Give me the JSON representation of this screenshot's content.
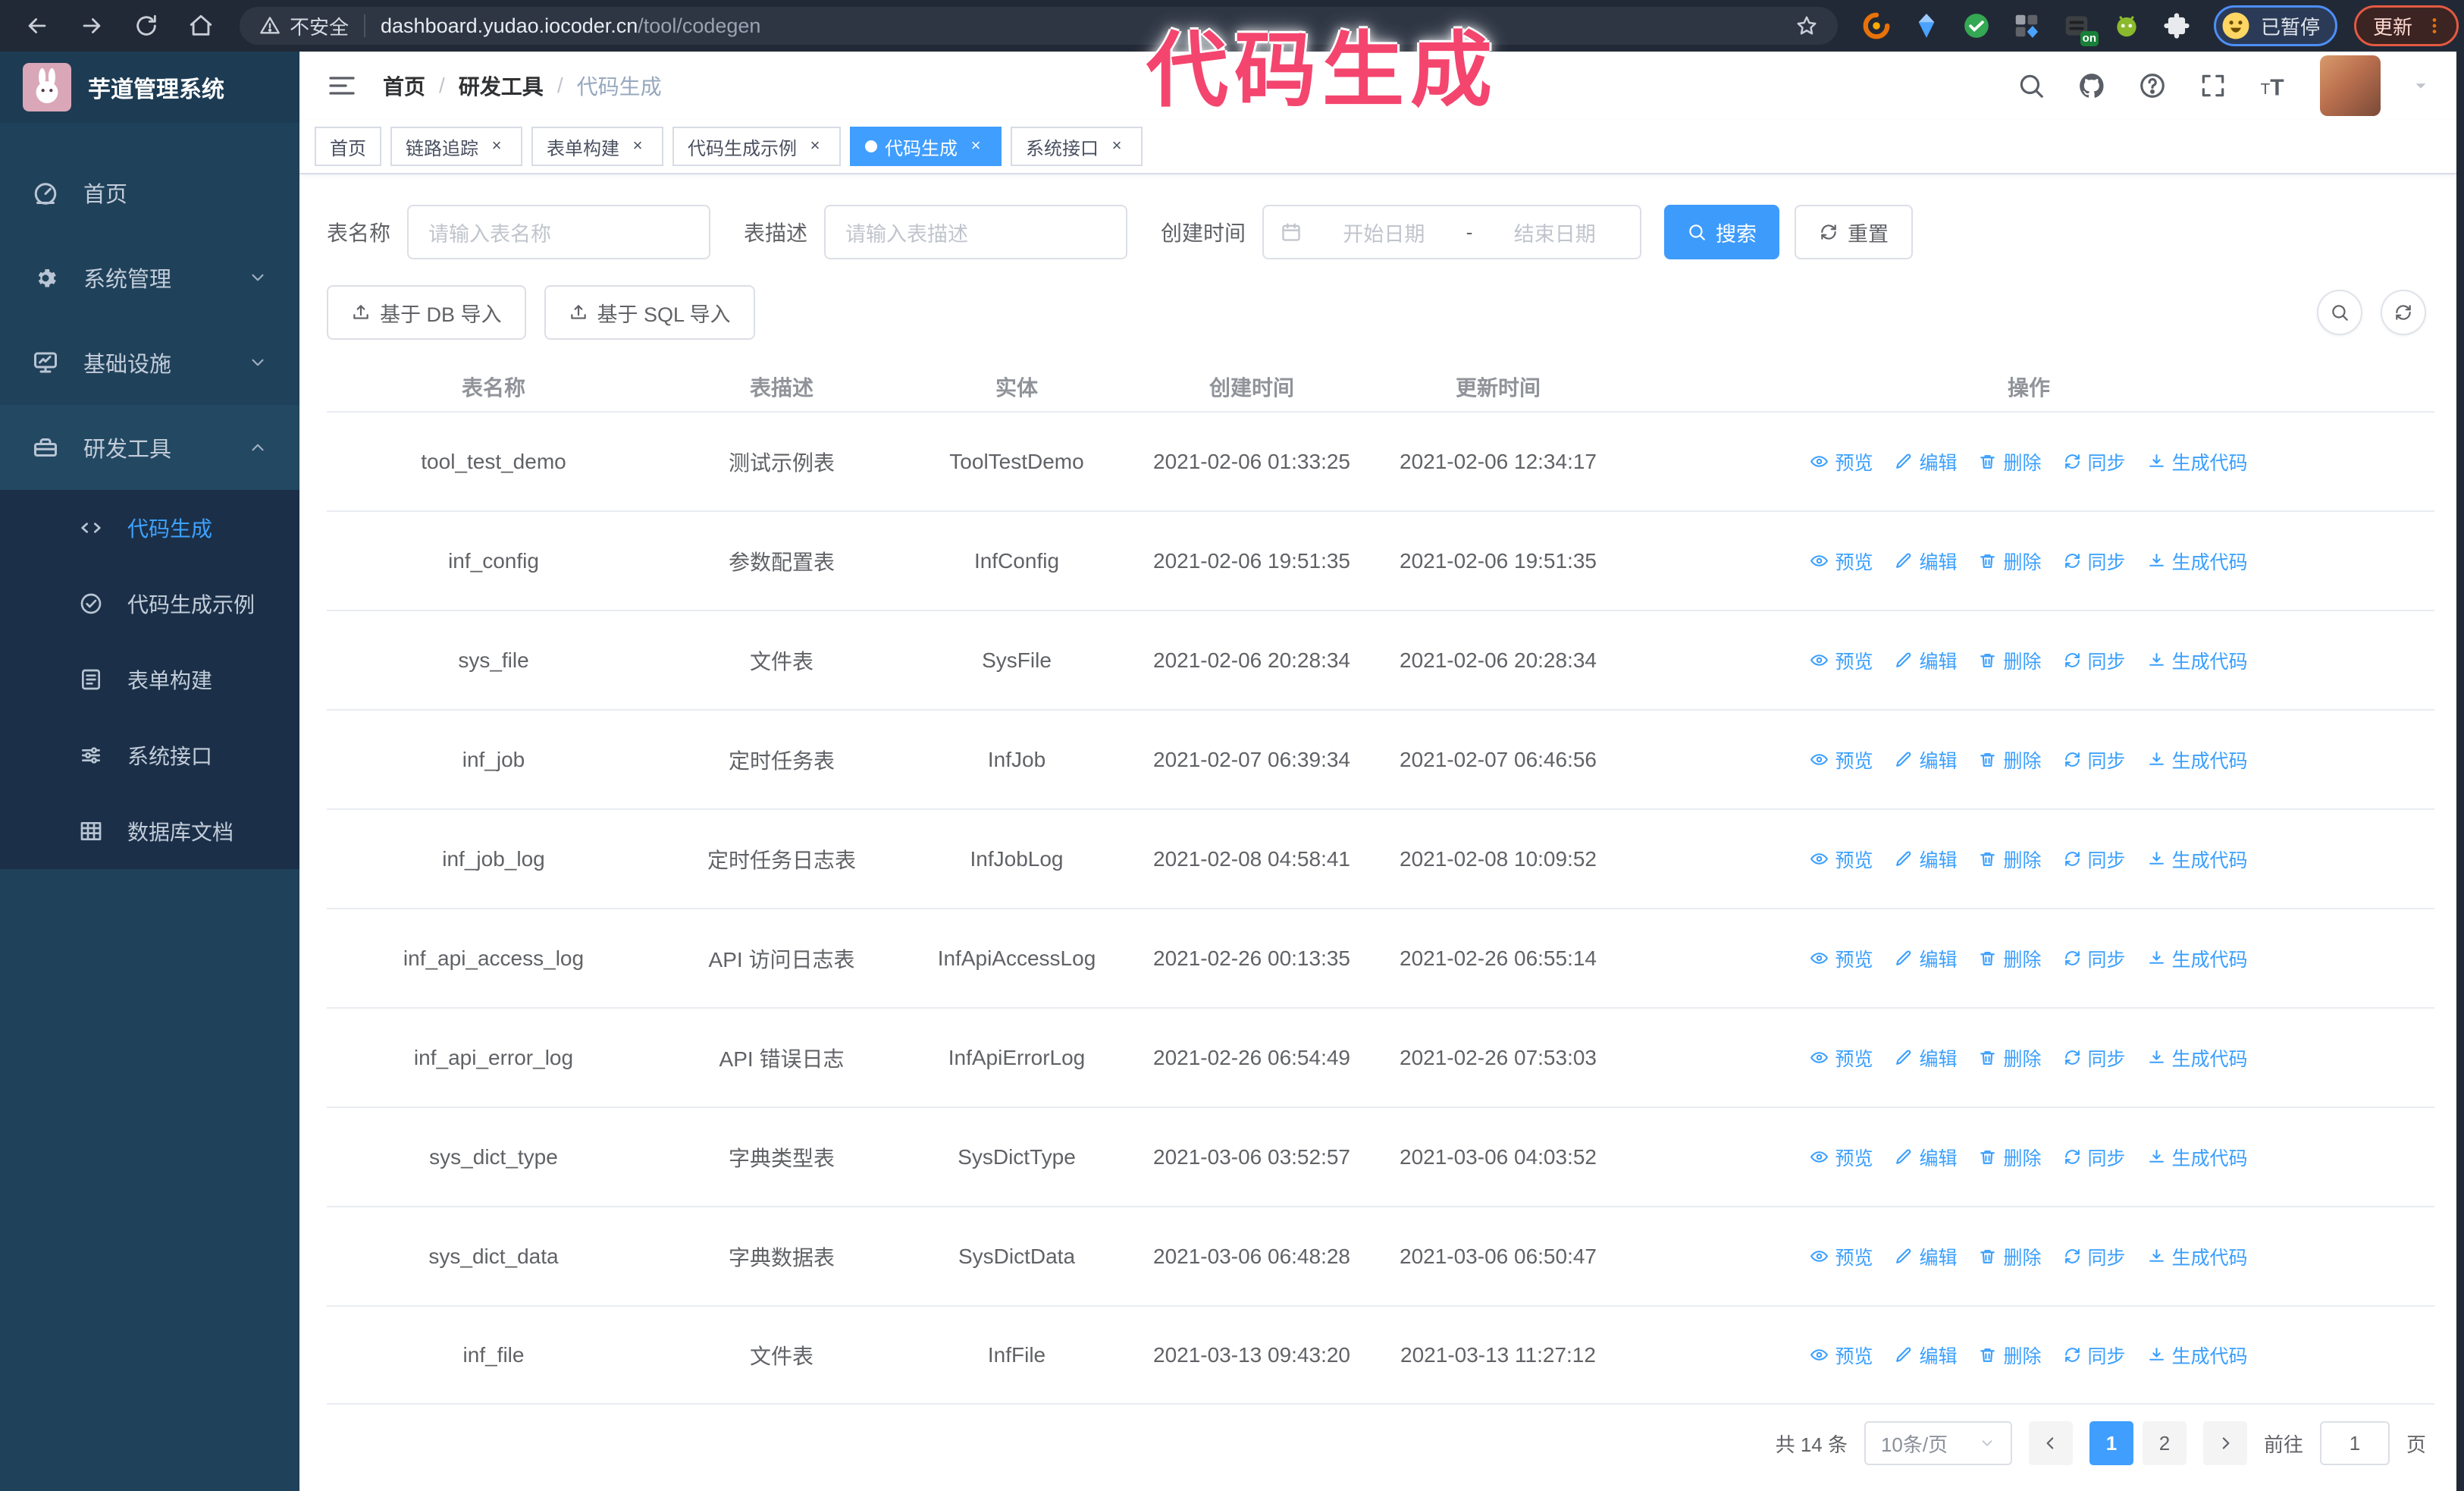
{
  "colors": {
    "accent": "#409eff",
    "sidebar_bg": "#20415a",
    "submenu_bg": "#1b3048",
    "annotation": "#f4456e"
  },
  "browser": {
    "security_label": "不安全",
    "url_host": "dashboard.yudao.iocoder.cn",
    "url_path": "/tool/codegen",
    "profile_chip": "已暂停",
    "update_button": "更新",
    "extensions": [
      {
        "icon": "orange-swirl-extension-icon",
        "badge": ""
      },
      {
        "icon": "blue-gem-extension-icon",
        "badge": ""
      },
      {
        "icon": "green-check-extension-icon",
        "badge": ""
      },
      {
        "icon": "grid-extension-icon",
        "badge": ""
      },
      {
        "icon": "dark-extension-icon",
        "badge": "on"
      },
      {
        "icon": "green-bot-extension-icon",
        "badge": ""
      },
      {
        "icon": "puzzle-extensions-icon",
        "badge": ""
      }
    ]
  },
  "annotation": {
    "text": "代码生成"
  },
  "sidebar": {
    "logo_title": "芋道管理系统",
    "menu": [
      {
        "label": "首页",
        "icon": "dashboard-icon",
        "chevron": ""
      },
      {
        "label": "系统管理",
        "icon": "gear-icon",
        "chevron": "down"
      },
      {
        "label": "基础设施",
        "icon": "monitor-icon",
        "chevron": "down"
      },
      {
        "label": "研发工具",
        "icon": "toolbox-icon",
        "chevron": "up",
        "open": true
      }
    ],
    "submenu": [
      {
        "label": "代码生成",
        "icon": "code-icon",
        "active": true
      },
      {
        "label": "代码生成示例",
        "icon": "example-icon",
        "active": false
      },
      {
        "label": "表单构建",
        "icon": "form-icon",
        "active": false
      },
      {
        "label": "系统接口",
        "icon": "api-icon",
        "active": false
      },
      {
        "label": "数据库文档",
        "icon": "database-doc-icon",
        "active": false
      }
    ]
  },
  "breadcrumb": {
    "items": [
      "首页",
      "研发工具"
    ],
    "current": "代码生成",
    "separator": "/"
  },
  "tags": [
    {
      "label": "首页",
      "closable": false,
      "active": false
    },
    {
      "label": "链路追踪",
      "closable": true,
      "active": false
    },
    {
      "label": "表单构建",
      "closable": true,
      "active": false
    },
    {
      "label": "代码生成示例",
      "closable": true,
      "active": false
    },
    {
      "label": "代码生成",
      "closable": true,
      "active": true
    },
    {
      "label": "系统接口",
      "closable": true,
      "active": false
    }
  ],
  "search": {
    "name_label": "表名称",
    "name_placeholder": "请输入表名称",
    "desc_label": "表描述",
    "desc_placeholder": "请输入表描述",
    "time_label": "创建时间",
    "start_placeholder": "开始日期",
    "range_separator": "-",
    "end_placeholder": "结束日期",
    "search_button": "搜索",
    "reset_button": "重置"
  },
  "import": {
    "db_button": "基于 DB 导入",
    "sql_button": "基于 SQL 导入"
  },
  "table": {
    "columns": [
      "表名称",
      "表描述",
      "实体",
      "创建时间",
      "更新时间",
      "操作"
    ],
    "action_labels": [
      {
        "label": "预览",
        "icon": "eye-icon"
      },
      {
        "label": "编辑",
        "icon": "edit-icon"
      },
      {
        "label": "删除",
        "icon": "delete-icon"
      },
      {
        "label": "同步",
        "icon": "sync-icon"
      },
      {
        "label": "生成代码",
        "icon": "download-icon"
      }
    ],
    "rows": [
      {
        "name": "tool_test_demo",
        "desc": "测试示例表",
        "entity": "ToolTestDemo",
        "created": "2021-02-06 01:33:25",
        "updated": "2021-02-06 12:34:17"
      },
      {
        "name": "inf_config",
        "desc": "参数配置表",
        "entity": "InfConfig",
        "created": "2021-02-06 19:51:35",
        "updated": "2021-02-06 19:51:35"
      },
      {
        "name": "sys_file",
        "desc": "文件表",
        "entity": "SysFile",
        "created": "2021-02-06 20:28:34",
        "updated": "2021-02-06 20:28:34"
      },
      {
        "name": "inf_job",
        "desc": "定时任务表",
        "entity": "InfJob",
        "created": "2021-02-07 06:39:34",
        "updated": "2021-02-07 06:46:56"
      },
      {
        "name": "inf_job_log",
        "desc": "定时任务日志表",
        "entity": "InfJobLog",
        "created": "2021-02-08 04:58:41",
        "updated": "2021-02-08 10:09:52"
      },
      {
        "name": "inf_api_access_log",
        "desc": "API 访问日志表",
        "entity": "InfApiAccessLog",
        "created": "2021-02-26 00:13:35",
        "updated": "2021-02-26 06:55:14"
      },
      {
        "name": "inf_api_error_log",
        "desc": "API 错误日志",
        "entity": "InfApiErrorLog",
        "created": "2021-02-26 06:54:49",
        "updated": "2021-02-26 07:53:03"
      },
      {
        "name": "sys_dict_type",
        "desc": "字典类型表",
        "entity": "SysDictType",
        "created": "2021-03-06 03:52:57",
        "updated": "2021-03-06 04:03:52"
      },
      {
        "name": "sys_dict_data",
        "desc": "字典数据表",
        "entity": "SysDictData",
        "created": "2021-03-06 06:48:28",
        "updated": "2021-03-06 06:50:47"
      },
      {
        "name": "inf_file",
        "desc": "文件表",
        "entity": "InfFile",
        "created": "2021-03-13 09:43:20",
        "updated": "2021-03-13 11:27:12"
      }
    ]
  },
  "pagination": {
    "total": "共 14 条",
    "page_size": "10条/页",
    "pages": [
      "1",
      "2"
    ],
    "active_page": "1",
    "goto_label": "前往",
    "goto_value": "1",
    "page_unit": "页"
  }
}
